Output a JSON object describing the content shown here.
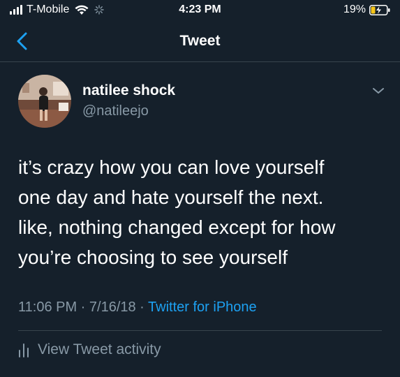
{
  "status_bar": {
    "carrier": "T-Mobile",
    "time": "4:23 PM",
    "battery": "19%",
    "icons": [
      "signal-icon",
      "wifi-icon",
      "activity-icon",
      "battery-charging-icon"
    ]
  },
  "nav": {
    "title": "Tweet",
    "back_icon": "chevron-left-icon"
  },
  "author": {
    "display_name": "natilee shock",
    "handle": "@natileejo"
  },
  "tweet": {
    "lines": [
      "it’s crazy how you can love yourself",
      "one day and hate yourself the next.",
      "like, nothing changed except for how",
      "you’re choosing to see yourself"
    ],
    "timestamp": "11:06 PM · 7/16/18 · ",
    "source": "Twitter for iPhone"
  },
  "activity": {
    "label": "View Tweet activity"
  },
  "colors": {
    "background": "#15202b",
    "accent": "#1da1f2",
    "secondary_text": "#8899a6",
    "divider": "#38444d"
  }
}
